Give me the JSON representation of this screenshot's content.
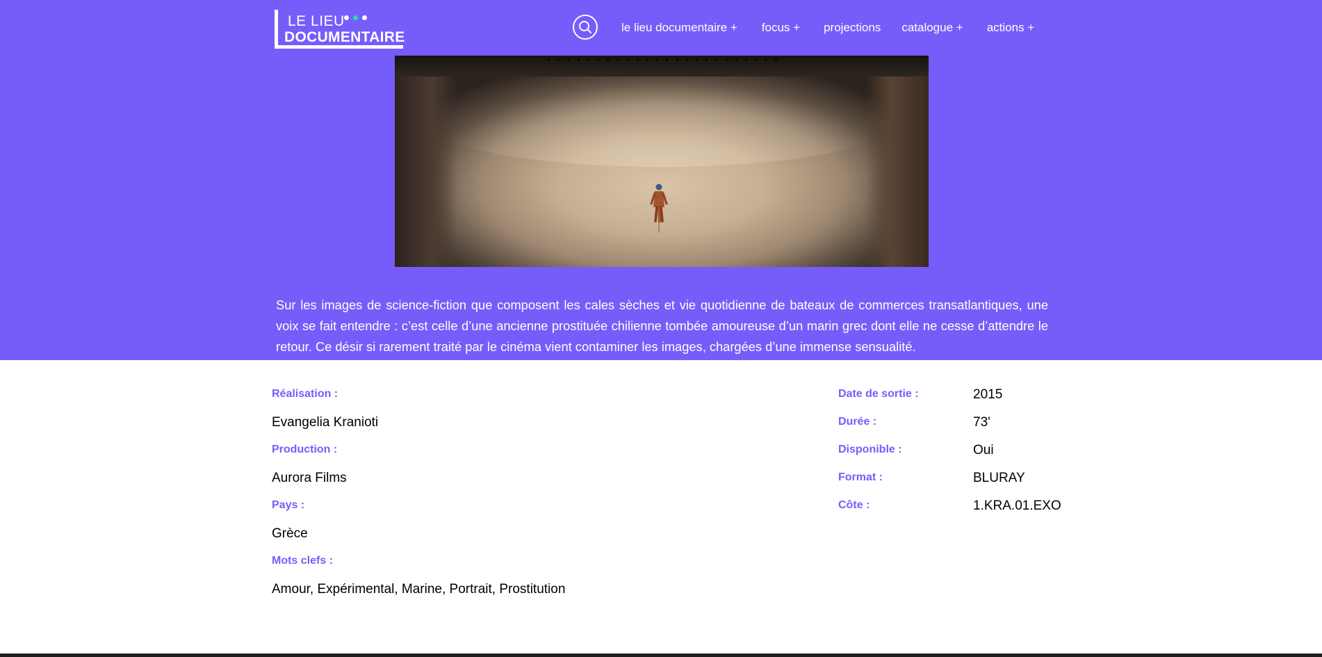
{
  "logo": {
    "line1": "LE LIEU",
    "line2": "DOCUMENTAIRE"
  },
  "nav": {
    "items": [
      {
        "label": "le lieu documentaire +"
      },
      {
        "label": "focus +"
      },
      {
        "label": "projections"
      },
      {
        "label": "catalogue +"
      },
      {
        "label": "actions +"
      }
    ]
  },
  "description": "Sur les images de science-fiction que composent les cales sèches et vie quotidienne de bateaux de commerces transatlantiques, une voix se fait entendre : c’est celle d’une ancienne prostituée chilienne tombée amoureuse d’un marin grec dont elle ne cesse d’attendre le retour. Ce désir si rarement traité par le cinéma vient contaminer les images, chargées d’une immense sensualité.",
  "details": {
    "realisation_label": "Réalisation :",
    "realisation": "Evangelia Kranioti",
    "production_label": "Production :",
    "production": "Aurora Films",
    "pays_label": "Pays :",
    "pays": "Grèce",
    "mots_clefs_label": "Mots clefs :",
    "mots_clefs": "Amour, Expérimental, Marine, Portrait, Prostitution",
    "date_label": "Date de sortie :",
    "date": "2015",
    "duree_label": "Durée :",
    "duree": "73'",
    "disponible_label": "Disponible :",
    "disponible": "Oui",
    "format_label": "Format :",
    "format": "BLURAY",
    "cote_label": "Côte :",
    "cote": "1.KRA.01.EXO"
  },
  "colors": {
    "brand": "#765dfa",
    "accent_dot": "#27dca8",
    "text": "#000000",
    "on_brand": "#ffffff"
  }
}
